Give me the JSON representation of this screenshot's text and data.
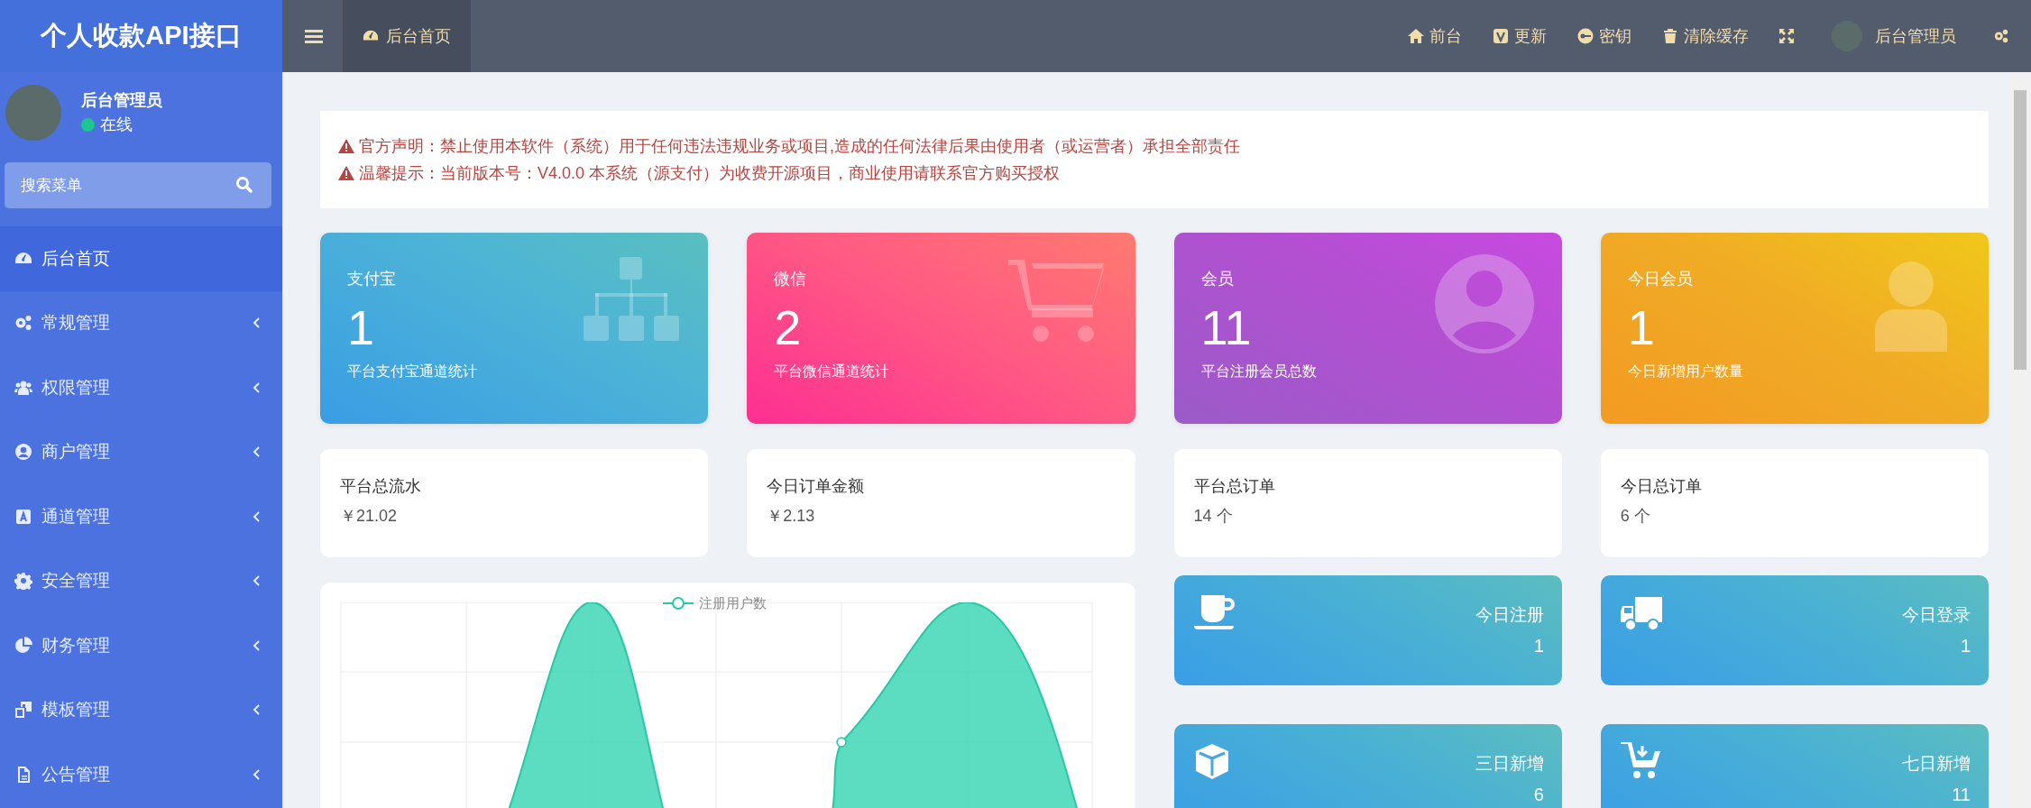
{
  "brand": "个人收款API接口",
  "user": {
    "name": "后台管理员",
    "status": "在线",
    "online": true
  },
  "sidebar_search": {
    "placeholder": "搜索菜单"
  },
  "sidebar": {
    "items": [
      {
        "label": "后台首页",
        "selected": true,
        "expandable": false
      },
      {
        "label": "常规管理",
        "selected": false,
        "expandable": true
      },
      {
        "label": "权限管理",
        "selected": false,
        "expandable": true
      },
      {
        "label": "商户管理",
        "selected": false,
        "expandable": true
      },
      {
        "label": "通道管理",
        "selected": false,
        "expandable": true
      },
      {
        "label": "安全管理",
        "selected": false,
        "expandable": true
      },
      {
        "label": "财务管理",
        "selected": false,
        "expandable": true
      },
      {
        "label": "模板管理",
        "selected": false,
        "expandable": true
      },
      {
        "label": "公告管理",
        "selected": false,
        "expandable": true
      }
    ]
  },
  "topbar": {
    "tabs": [
      {
        "label": "后台首页",
        "selected": true
      }
    ],
    "links": [
      {
        "label": "前台"
      },
      {
        "label": "更新"
      },
      {
        "label": "密钥"
      },
      {
        "label": "清除缓存"
      }
    ],
    "user_name": "后台管理员"
  },
  "notices": [
    "官方声明：禁止使用本软件（系统）用于任何违法违规业务或项目,造成的任何法律后果由使用者（或运营者）承担全部责任",
    "温馨提示：当前版本号：V4.0.0 本系统（源支付）为收费开源项目，商业使用请联系官方购买授权"
  ],
  "stat_cards": [
    {
      "title": "支付宝",
      "value": "1",
      "caption": "平台支付宝通道统计"
    },
    {
      "title": "微信",
      "value": "2",
      "caption": "平台微信通道统计"
    },
    {
      "title": "会员",
      "value": "11",
      "caption": "平台注册会员总数"
    },
    {
      "title": "今日会员",
      "value": "1",
      "caption": "今日新增用户数量"
    }
  ],
  "summary_cards": [
    {
      "label": "平台总流水",
      "value": "￥21.02"
    },
    {
      "label": "今日订单金额",
      "value": "￥2.13"
    },
    {
      "label": "平台总订单",
      "value": "14 个"
    },
    {
      "label": "今日总订单",
      "value": "6 个"
    }
  ],
  "chart": {
    "legend": "注册用户数"
  },
  "mini_cards": [
    {
      "label": "今日注册",
      "value": "1"
    },
    {
      "label": "今日登录",
      "value": "1"
    },
    {
      "label": "三日新增",
      "value": "6"
    },
    {
      "label": "七日新增",
      "value": "11"
    }
  ]
}
